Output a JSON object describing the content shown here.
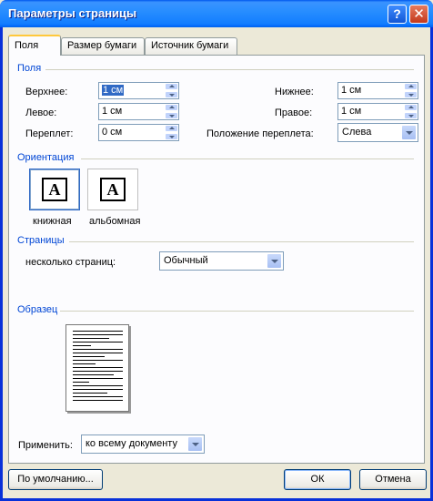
{
  "window": {
    "title": "Параметры страницы",
    "help_glyph": "?",
    "close_glyph": "✕"
  },
  "tabs": [
    {
      "label": "Поля",
      "active": true
    },
    {
      "label": "Размер бумаги",
      "active": false
    },
    {
      "label": "Источник бумаги",
      "active": false
    }
  ],
  "margins": {
    "group_title": "Поля",
    "top": {
      "label": "Верхнее:",
      "value": "1 см"
    },
    "bottom": {
      "label": "Нижнее:",
      "value": "1 см"
    },
    "left": {
      "label": "Левое:",
      "value": "1 см"
    },
    "right": {
      "label": "Правое:",
      "value": "1 см"
    },
    "gutter": {
      "label": "Переплет:",
      "value": "0 см"
    },
    "gutter_pos": {
      "label": "Положение переплета:",
      "value": "Слева"
    }
  },
  "orientation": {
    "group_title": "Ориентация",
    "portrait": {
      "label": "книжная",
      "glyph": "A",
      "selected": true
    },
    "landscape": {
      "label": "альбомная",
      "glyph": "A",
      "selected": false
    }
  },
  "pages": {
    "group_title": "Страницы",
    "label": "несколько страниц:",
    "value": "Обычный"
  },
  "sample": {
    "group_title": "Образец"
  },
  "apply": {
    "label": "Применить:",
    "value": "ко всему документу"
  },
  "buttons": {
    "default_label": "По умолчанию...",
    "ok_label": "ОК",
    "cancel_label": "Отмена"
  },
  "colors": {
    "titlebar": "#0058ee",
    "group_title": "#0046d5",
    "tab_highlight": "#ffc83c",
    "selection": "#316ac5"
  }
}
